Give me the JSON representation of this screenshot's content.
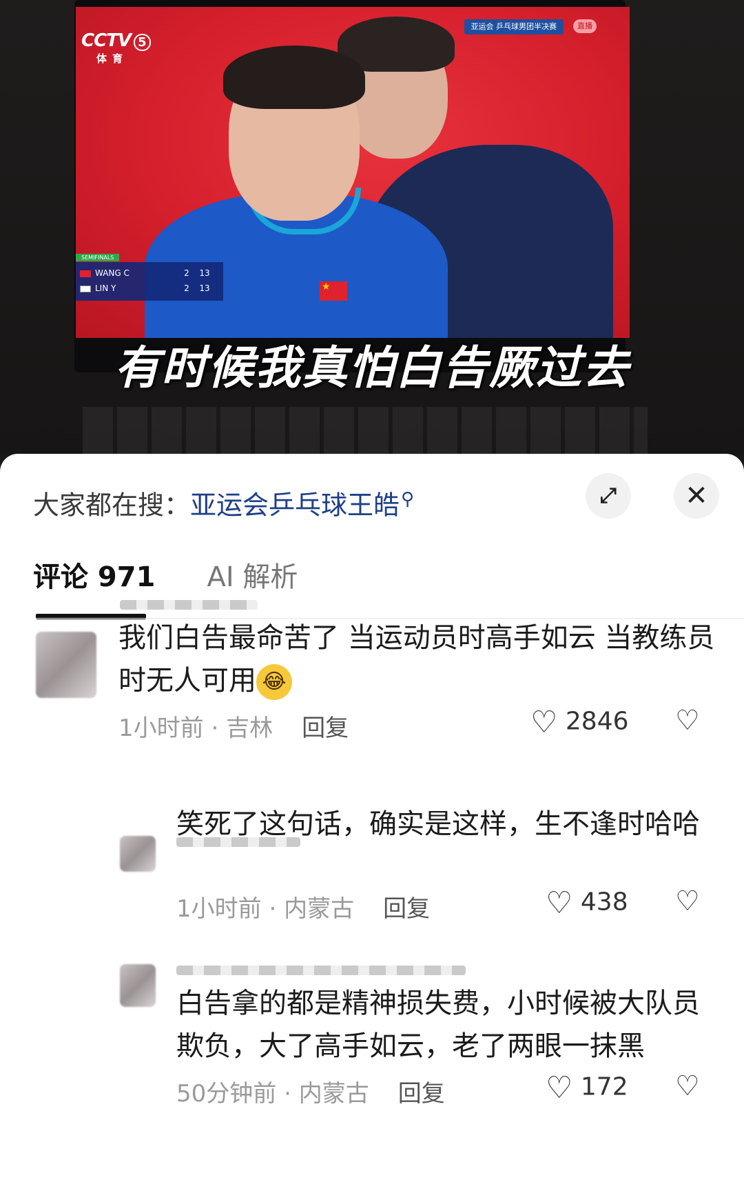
{
  "video": {
    "channel_logo": "CCTV",
    "channel_number": "5",
    "channel_sub": "体育",
    "live_banner": "亚运会  乒乓球男团半决赛",
    "live_badge": "直播",
    "scoreboard": {
      "stage": "SEMIFINALS",
      "rows": [
        {
          "name": "WANG C",
          "set": "2",
          "points": "13"
        },
        {
          "name": "LIN Y",
          "set": "2",
          "points": "13"
        }
      ]
    },
    "caption": "有时候我真怕白告厥过去"
  },
  "sheet": {
    "search_prefix": "大家都在搜：",
    "search_term": "亚运会乒乓球王皓",
    "expand_icon": "expand-icon",
    "close_icon": "close-icon",
    "tabs": [
      {
        "label": "评论 971",
        "active": true
      },
      {
        "label": "AI 解析",
        "active": false
      }
    ]
  },
  "comments": [
    {
      "text": "我们白告最命苦了 当运动员时高手如云 当教练员时无人可用",
      "emoji": "crying-laughing-emoji",
      "time": "1小时前",
      "location": "吉林",
      "reply": "回复",
      "likes": "2846"
    },
    {
      "text": "笑死了这句话，确实是这样，生不逢时哈哈",
      "time": "1小时前",
      "location": "内蒙古",
      "reply": "回复",
      "likes": "438"
    },
    {
      "text": "白告拿的都是精神损失费，小时候被大队员欺负，大了高手如云，老了两眼一抹黑",
      "time": "50分钟前",
      "location": "内蒙古",
      "reply": "回复",
      "likes": "172"
    }
  ],
  "colors": {
    "search_term": "#1f3f87",
    "tv_background": "#d51f2c",
    "meta_text": "#9a9a9a"
  }
}
